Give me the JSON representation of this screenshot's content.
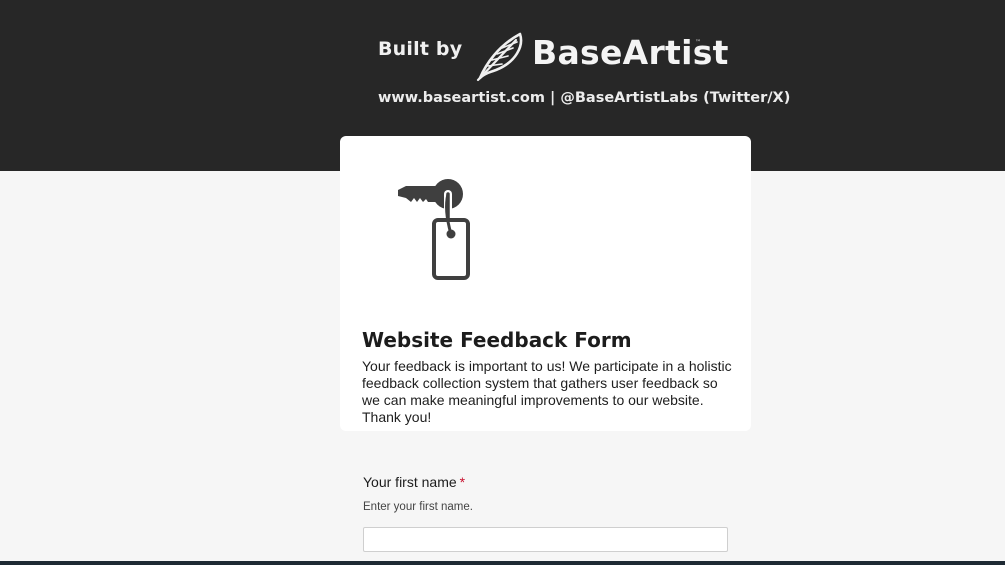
{
  "header": {
    "built_by_label": "Built by",
    "brand_name": "BaseArtist",
    "trademark": "™",
    "subline": "www.baseartist.com | @BaseArtistLabs (Twitter/X)",
    "background_color": "#272727"
  },
  "icons": {
    "brand": "feather-icon",
    "form": "key-tag-icon"
  },
  "form": {
    "title": "Website Feedback Form",
    "description": "Your feedback is important to us! We participate in a holistic feedback collection system that gathers user feedback so we can make meaningful improvements to our website. Thank you!"
  },
  "fields": {
    "first_name": {
      "label": "Your first name",
      "required_mark": "*",
      "hint": "Enter your first name.",
      "value": "",
      "placeholder": ""
    }
  },
  "colors": {
    "page_background": "#f6f6f6",
    "card_background": "#ffffff",
    "required": "#c8102e"
  }
}
